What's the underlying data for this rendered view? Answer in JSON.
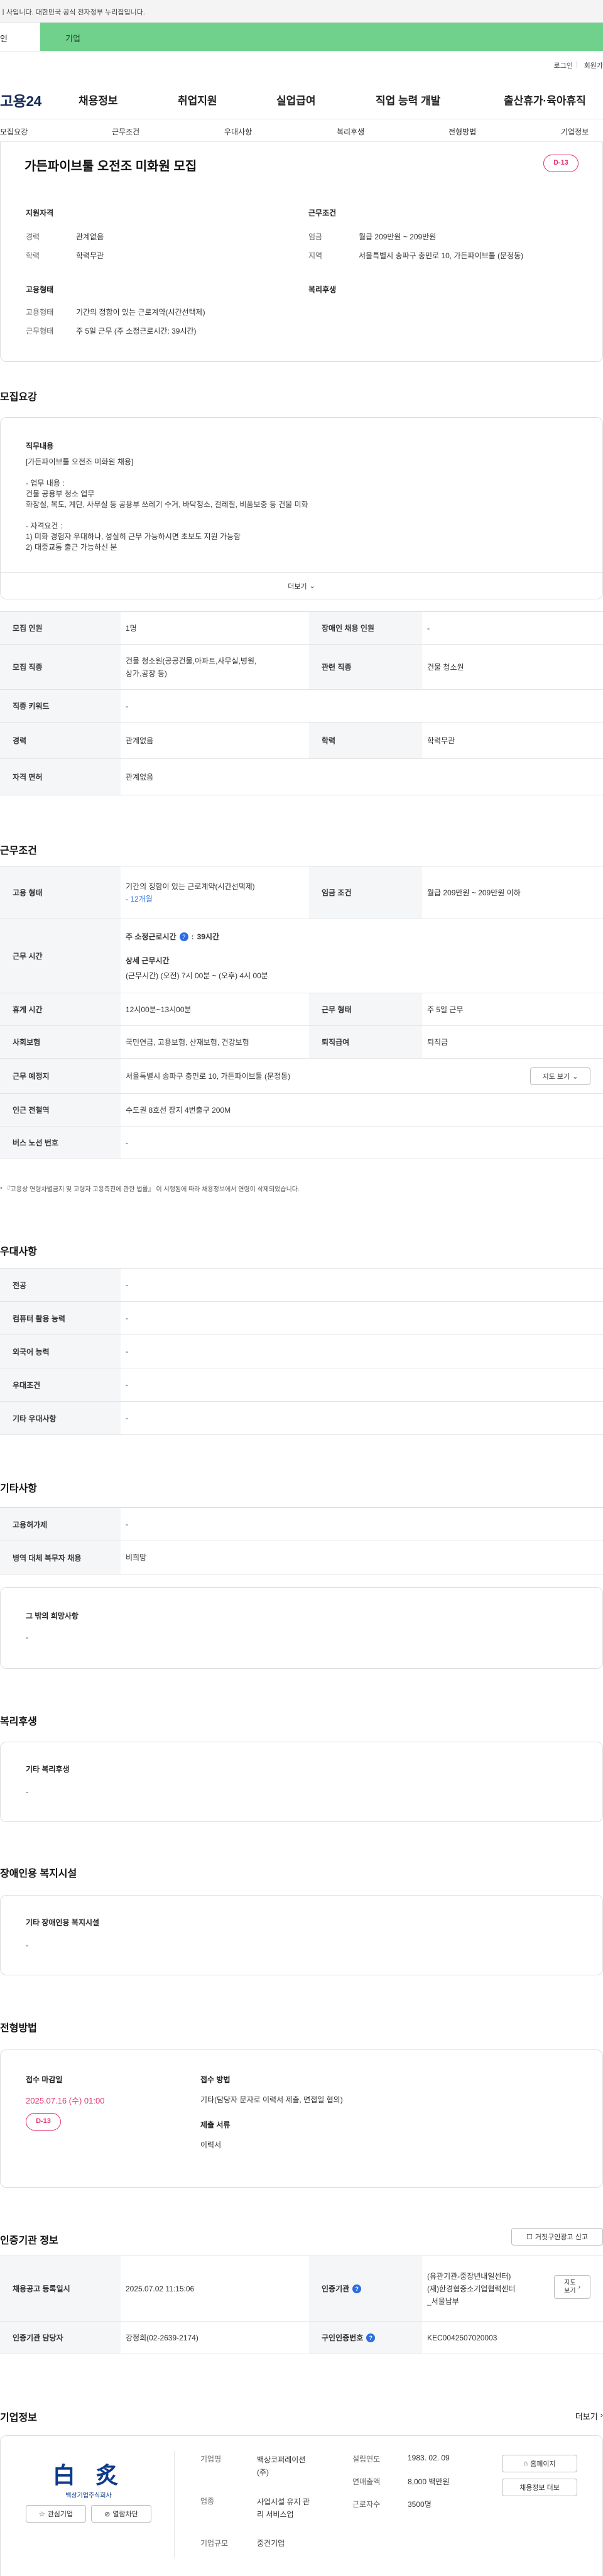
{
  "top_banner": {
    "text": "ㅣ사입니다. 대한민국 공식 전자정부 누리집입니다."
  },
  "tabs": {
    "personal": "인",
    "corporate": "기업"
  },
  "utility": {
    "login": "로그인",
    "separator": "|",
    "join": "회원가"
  },
  "gnb": {
    "logo": "고용24",
    "items": [
      "채용정보",
      "취업지원",
      "실업급여",
      "직업 능력 개발",
      "출산휴가·육아휴직"
    ]
  },
  "subnav": {
    "items": [
      "모집요강",
      "근무조건",
      "우대사항",
      "복리후생",
      "전형방법",
      "기업정보"
    ]
  },
  "job": {
    "title": "가든파이브툴 오전조 미화원 모집",
    "dday": "D-13",
    "qualification_heading": "지원자격",
    "career_label": "경력",
    "career_value": "관계없음",
    "education_label": "학력",
    "education_value": "학력무관",
    "conditions_heading": "근무조건",
    "wage_label": "임금",
    "wage_value": "월급 209만원 ~ 209만원",
    "region_label": "지역",
    "region_value": "서울특별시 송파구 충민로 10, 가든파이브툴 (문정동)",
    "employment_heading": "고용형태",
    "emp_type_label": "고용형태",
    "emp_type_value": "기간의 정함이 있는 근로계약(시간선택제)",
    "work_type_label": "근무형태",
    "work_type_value": "주 5일 근무 (주 소정근로시간: 39시간)",
    "welfare_heading": "복리후생"
  },
  "recruit": {
    "title": "모집요강",
    "duty_heading": "직무내용",
    "duty_text": "[가든파이브툴 오전조 미화원 채용]\n\n- 업무 내용 :\n건물 공용부 청소 업무\n화장실, 복도, 계단, 사무실 등 공용부 쓰레기 수거, 바닥청소, 걸레질, 비품보충 등 건물 미화\n\n- 자격요건 :\n1) 미화 경험자 우대하나, 성실히 근무 가능하시면 초보도 지원 가능함\n2) 대중교통 출근 가능하신 분",
    "more_label": "더보기",
    "rows": {
      "headcount_label": "모집 인원",
      "headcount_value": "1명",
      "disabled_label": "장애인 채용 인원",
      "disabled_value": "-",
      "job_label": "모집 직종",
      "job_value": "건물 청소원(공공건물,아파트,사무실,병원,\n상가,공장 등)",
      "related_label": "관련 직종",
      "related_value": "건물 청소원",
      "keyword_label": "직종 키워드",
      "keyword_value": "-",
      "career_label": "경력",
      "career_value": "관계없음",
      "edu_label": "학력",
      "edu_value": "학력무관",
      "license_label": "자격 면허",
      "license_value": "관계없음"
    }
  },
  "conditions": {
    "title": "근무조건",
    "emp_type_label": "고용 형태",
    "emp_type_value": "기간의 정함이 있는 근로계약(시간선택제)",
    "emp_type_period": "- 12개월",
    "wage_label": "임금 조건",
    "wage_value": "월급 209만원 ~ 209만원 이하",
    "hours_label": "근무 시간",
    "weekly_label": "주 소정근로시간",
    "weekly_value": "39시간",
    "detail_label": "상세 근무시간",
    "detail_value": "(근무시간) (오전) 7시 00분 ~ (오후) 4시 00분",
    "break_label": "휴게 시간",
    "break_value": "12시00분~13시00분",
    "form_label": "근무 형태",
    "form_value": "주 5일 근무",
    "insurance_label": "사회보험",
    "insurance_value": "국민연금, 고용보험, 산재보험, 건강보험",
    "severance_label": "퇴직급여",
    "severance_value": "퇴직금",
    "place_label": "근무 예정지",
    "place_value": "서울특별시 송파구 충민로 10, 가든파이브툴 (문정동)",
    "map_button": "지도 보기",
    "subway_label": "인근 전철역",
    "subway_value": "수도권 8호선 장지 4번출구 200M",
    "bus_label": "버스 노선 번호",
    "bus_value": "-",
    "note": "* 『고용상 연령차별금지 및 고령자 고용촉진에 관한 법률』 이 시행됨에 따라 채용정보에서 연령이 삭제되었습니다."
  },
  "preference": {
    "title": "우대사항",
    "rows": [
      {
        "label": "전공",
        "value": "-"
      },
      {
        "label": "컴퓨터 활용 능력",
        "value": "-"
      },
      {
        "label": "외국어 능력",
        "value": "-"
      },
      {
        "label": "우대조건",
        "value": "-"
      },
      {
        "label": "기타 우대사항",
        "value": "-"
      }
    ]
  },
  "other": {
    "title": "기타사항",
    "rows": [
      {
        "label": "고용허가제",
        "value": "-"
      },
      {
        "label": "병역 대체 복무자 채용",
        "value": "비희망"
      }
    ],
    "hope_heading": "그 밖의 희망사항",
    "hope_value": "-"
  },
  "welfare": {
    "title": "복리후생",
    "heading": "기타 복리후생",
    "value": "-"
  },
  "disability": {
    "title": "장애인용 복지시설",
    "heading": "기타 장애인용 복지시설",
    "value": "-"
  },
  "selection": {
    "title": "전형방법",
    "deadline_heading": "접수 마감일",
    "deadline_value": "2025.07.16 (수) 01:00",
    "dday": "D-13",
    "method_heading": "접수 방법",
    "method_value": "기타(담당자 문자로 이력서 제출, 면접일 협의)",
    "docs_heading": "제출 서류",
    "docs_value": "이력서"
  },
  "cert": {
    "title": "인증기관 정보",
    "report_button": "거짓구인광고 신고",
    "reg_label": "채용공고 등록일시",
    "reg_value": "2025.07.02 11:15:06",
    "agency_label": "인증기관",
    "agency_value": "(유관기관-중장년내일센터)\n(재)한경협중소기업협력센터\n_서울남부",
    "map_button": "지도\n보기",
    "manager_label": "인증기관 담당자",
    "manager_value": "강정희(02-2639-2174)",
    "cert_no_label": "구인인증번호",
    "cert_no_value": "KEC0042507020003"
  },
  "company": {
    "title": "기업정보",
    "more": "더보기",
    "logo_main": "白 炙",
    "logo_sub": "백상기업주식회사",
    "interest_button": "관심기업",
    "block_button": "열람차단",
    "name_label": "기업명",
    "name_value": "백상코퍼레이션\n(주)",
    "industry_label": "업종",
    "industry_value": "사업시설 유지 관\n리 서비스업",
    "size_label": "기업규모",
    "size_value": "중견기업",
    "founded_label": "설립연도",
    "founded_value": "1983. 02. 09",
    "sales_label": "연매출액",
    "sales_value": "8,000 백만원",
    "employees_label": "근로자수",
    "employees_value": "3500명",
    "homepage_button": "홈페이지",
    "jobs_button": "채용정보 더보"
  },
  "colors": {
    "accent": "#e2336b",
    "tab_green": "#6fd18b",
    "link_blue": "#2c6de0",
    "navy": "#152c5a"
  }
}
